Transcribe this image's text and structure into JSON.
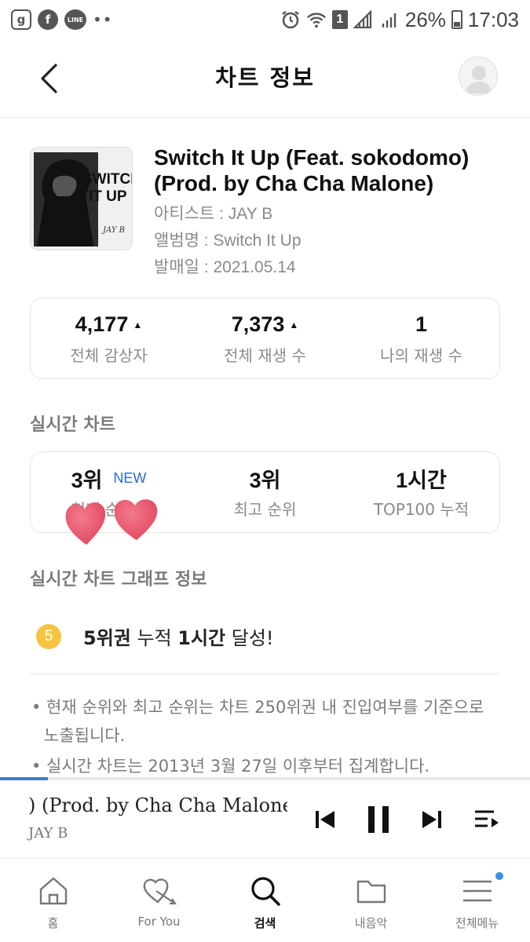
{
  "status_bar": {
    "app_icons": [
      "g",
      "f",
      "LINE"
    ],
    "more": "••",
    "sim_number": "1",
    "battery": "26%",
    "time": "17:03"
  },
  "header": {
    "title": "차트 정보"
  },
  "song": {
    "album_art_text": "SWITCH IT UP",
    "album_art_artist": "JAY B",
    "title": "Switch It Up (Feat. sokodomo) (Prod. by Cha Cha Malone)",
    "artist_line": "아티스트 : JAY B",
    "album_line": "앨범명 : Switch It Up",
    "release_line": "발매일 : 2021.05.14"
  },
  "stats": [
    {
      "value": "4,177",
      "trend": "up",
      "label": "전체 감상자"
    },
    {
      "value": "7,373",
      "trend": "up",
      "label": "전체 재생 수"
    },
    {
      "value": "1",
      "trend": "",
      "label": "나의 재생 수"
    }
  ],
  "realtime": {
    "heading": "실시간 차트",
    "current_rank": "3위",
    "current_badge": "NEW",
    "current_label": "현재 순위",
    "best_rank": "3위",
    "best_label": "최고 순위",
    "hours": "1시간",
    "hours_label": "TOP100 누적"
  },
  "graph": {
    "heading": "실시간 차트 그래프 정보",
    "badge": "5",
    "achievement_rank": "5위권",
    "achievement_mid": " 누적 ",
    "achievement_hours": "1시간",
    "achievement_end": " 달성!"
  },
  "notes": [
    "• 현재 순위와 최고 순위는 차트 250위권 내 진입여부를 기준으로 노출됩니다.",
    "• 실시간 차트는 2013년 3월 27일 이후부터 집계합니다."
  ],
  "player": {
    "title": ") (Prod. by Cha Cha Malone)",
    "artist": "JAY B",
    "progress": 0.09
  },
  "nav": [
    {
      "label": "홈",
      "icon": "home-icon"
    },
    {
      "label": "For You",
      "icon": "heart-arrow-icon"
    },
    {
      "label": "검색",
      "icon": "search-icon"
    },
    {
      "label": "내음악",
      "icon": "folder-icon"
    },
    {
      "label": "전체메뉴",
      "icon": "menu-icon"
    }
  ],
  "colors": {
    "accent_blue": "#2b6bd6",
    "badge_yellow": "#f5c542",
    "sticker_pink": "#e8506a"
  }
}
